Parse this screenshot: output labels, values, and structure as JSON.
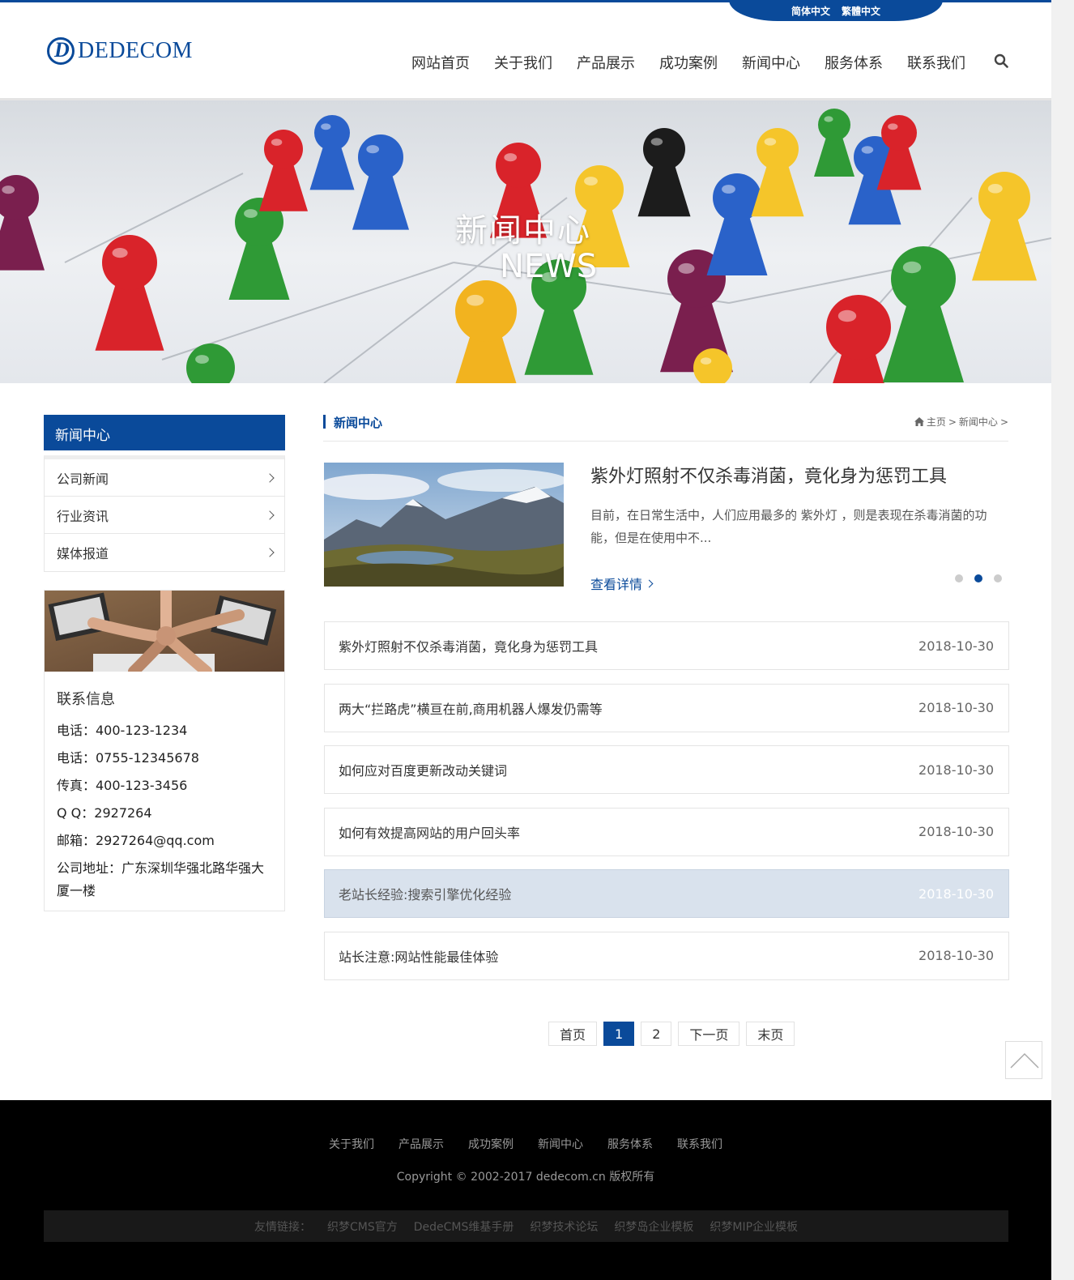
{
  "header": {
    "lang": [
      "简体中文",
      "繁體中文"
    ],
    "logo_text": "DEDECOM",
    "nav": [
      "网站首页",
      "关于我们",
      "产品展示",
      "成功案例",
      "新闻中心",
      "服务体系",
      "联系我们"
    ]
  },
  "banner": {
    "title": "新闻中心",
    "subtitle": "NEWS"
  },
  "sidebar": {
    "heading": "新闻中心",
    "items": [
      {
        "label": "公司新闻"
      },
      {
        "label": "行业资讯"
      },
      {
        "label": "媒体报道"
      }
    ],
    "contact": {
      "title": "联系信息",
      "lines": [
        "电话：400-123-1234",
        "电话：0755-12345678",
        "传真：400-123-3456",
        "Q Q：2927264",
        "邮箱：2927264@qq.com"
      ],
      "address": "公司地址：广东深圳华强北路华强大厦一楼"
    }
  },
  "main": {
    "section_title": "新闻中心",
    "breadcrumb": [
      "主页",
      ">",
      "新闻中心",
      ">"
    ],
    "featured": {
      "title": "紫外灯照射不仅杀毒消菌，竟化身为惩罚工具",
      "desc": "目前，在日常生活中，人们应用最多的 紫外灯 ，则是表现在杀毒消菌的功能，但是在使用中不...",
      "more": "查看详情",
      "slides": 3,
      "active_slide": 2
    },
    "news": [
      {
        "title": "紫外灯照射不仅杀毒消菌，竟化身为惩罚工具",
        "date": "2018-10-30"
      },
      {
        "title": "两大“拦路虎”横亘在前,商用机器人爆发仍需等",
        "date": "2018-10-30"
      },
      {
        "title": "如何应对百度更新改动关键词",
        "date": "2018-10-30"
      },
      {
        "title": "如何有效提高网站的用户回头率",
        "date": "2018-10-30"
      },
      {
        "title": "老站长经验:搜索引擎优化经验",
        "date": "2018-10-30"
      },
      {
        "title": "站长注意:网站性能最佳体验",
        "date": "2018-10-30"
      }
    ],
    "highlighted_row": 5,
    "pagination": [
      "首页",
      "1",
      "2",
      "下一页",
      "末页"
    ],
    "current_page": "1"
  },
  "footer": {
    "nav": [
      "关于我们",
      "产品展示",
      "成功案例",
      "新闻中心",
      "服务体系",
      "联系我们"
    ],
    "copyright": "Copyright © 2002-2017 dedecom.cn 版权所有",
    "links_label": "友情链接：",
    "links": [
      "织梦CMS官方",
      "DedeCMS维基手册",
      "织梦技术论坛",
      "织梦岛企业模板",
      "织梦MIP企业模板"
    ]
  },
  "colors": {
    "brand": "#0a4a9a",
    "highlight_row": "#d9e2ed",
    "footer_bg": "#000000"
  }
}
